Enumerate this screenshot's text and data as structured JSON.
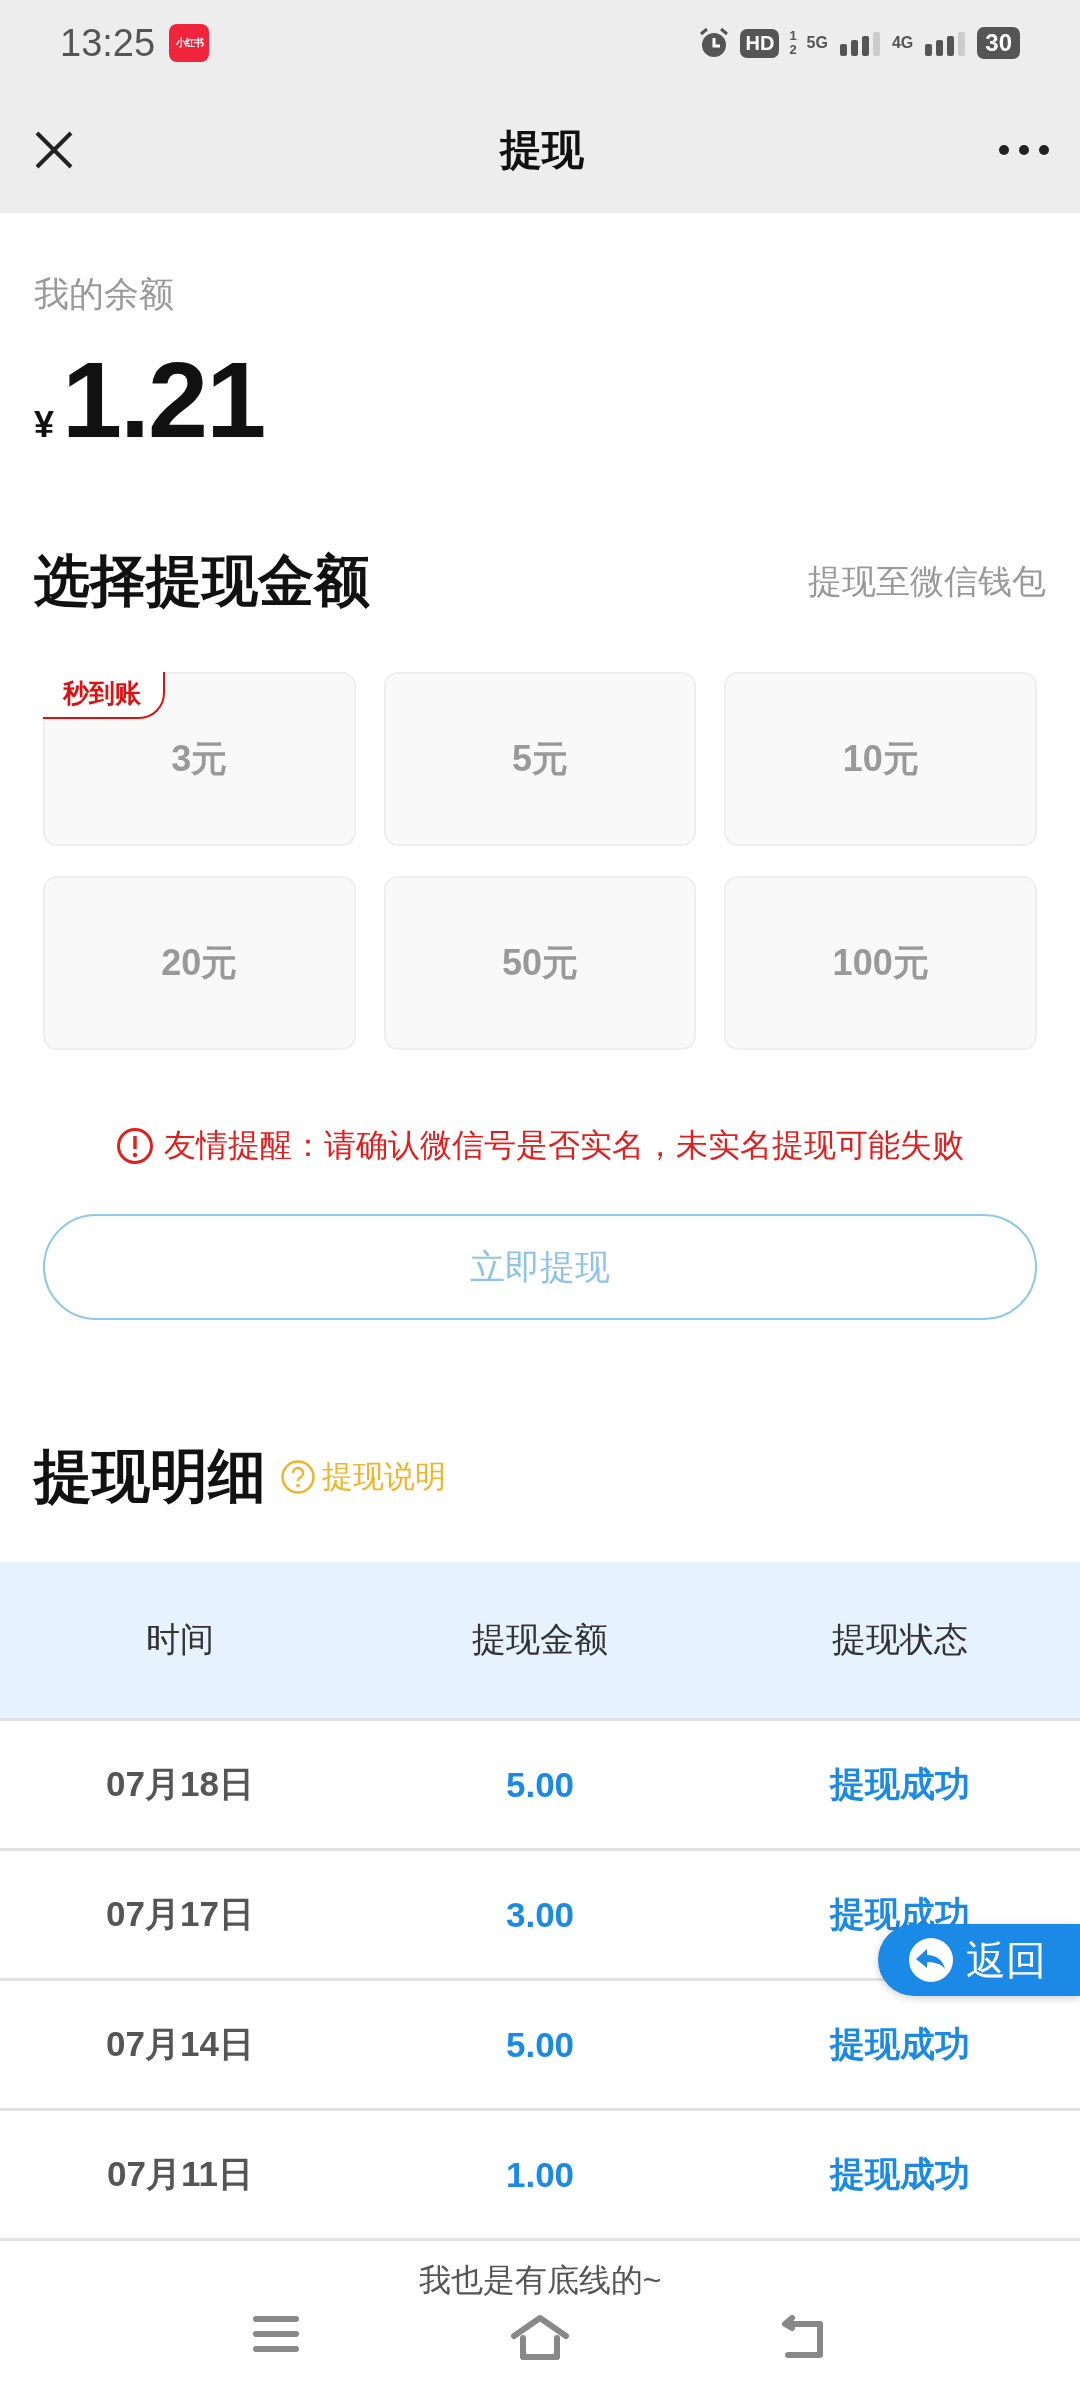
{
  "status_bar": {
    "time": "13:25",
    "app_badge": "小红书",
    "hd_label": "HD",
    "sim_1": "1",
    "sim_2": "2",
    "network_1": "5G",
    "network_2": "4G",
    "battery": "30"
  },
  "header": {
    "title": "提现"
  },
  "balance": {
    "label": "我的余额",
    "currency": "¥",
    "amount": "1.21"
  },
  "amount_section": {
    "title": "选择提现金额",
    "destination": "提现至微信钱包",
    "options": [
      {
        "label": "3元",
        "tag": "秒到账",
        "selected": false
      },
      {
        "label": "5元",
        "selected": false
      },
      {
        "label": "10元",
        "selected": false
      },
      {
        "label": "20元",
        "selected": false
      },
      {
        "label": "50元",
        "selected": false
      },
      {
        "label": "100元",
        "selected": false
      }
    ]
  },
  "notice": "友情提醒：请确认微信号是否实名，未实名提现可能失败",
  "submit_button": "立即提现",
  "records": {
    "title": "提现明细",
    "help_link": "提现说明",
    "columns": [
      "时间",
      "提现金额",
      "提现状态"
    ],
    "rows": [
      {
        "date": "07月18日",
        "amount": "5.00",
        "status": "提现成功"
      },
      {
        "date": "07月17日",
        "amount": "3.00",
        "status": "提现成功"
      },
      {
        "date": "07月14日",
        "amount": "5.00",
        "status": "提现成功"
      },
      {
        "date": "07月11日",
        "amount": "1.00",
        "status": "提现成功"
      }
    ]
  },
  "footer_text": "我也是有底线的~",
  "back_button": "返回"
}
